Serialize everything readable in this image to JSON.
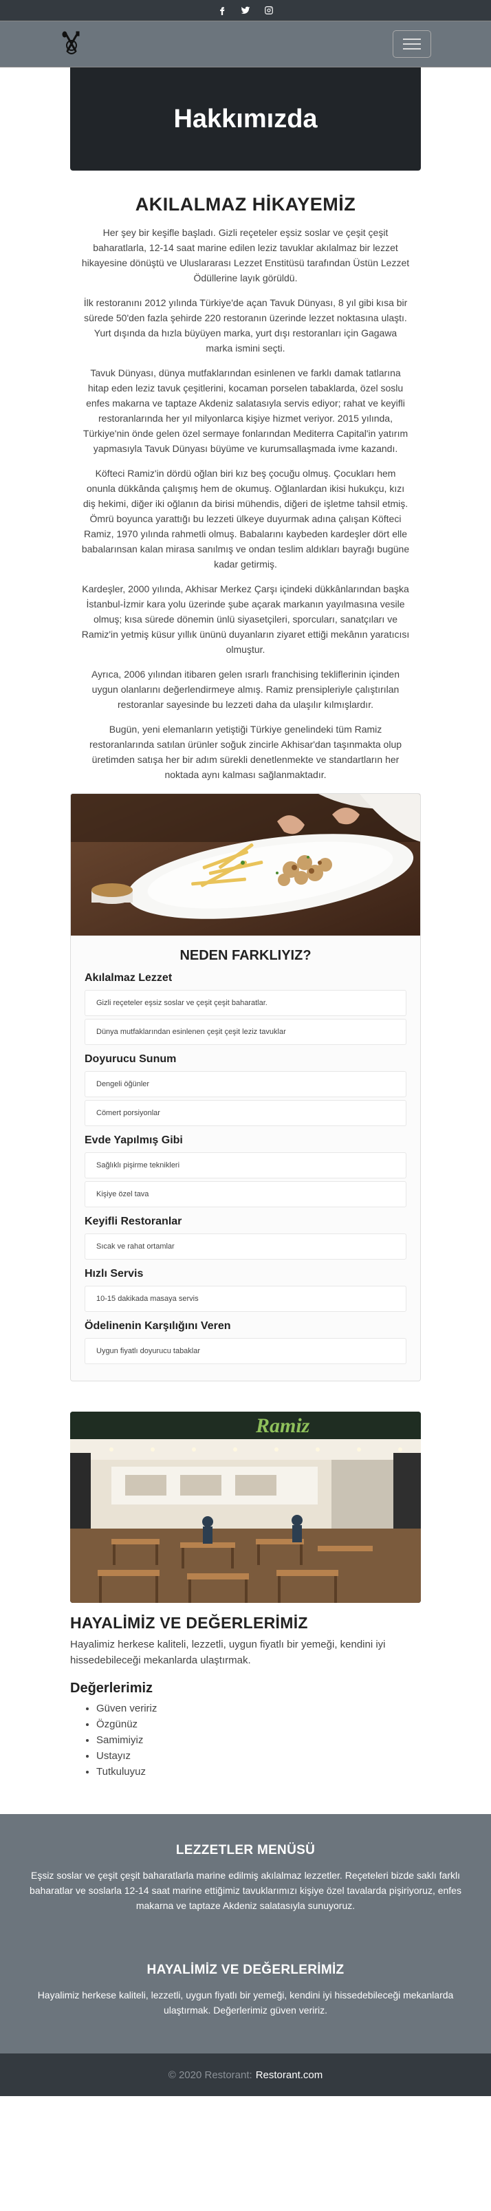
{
  "header": {
    "social": [
      "facebook-icon",
      "twitter-icon",
      "instagram-icon"
    ]
  },
  "hero": {
    "title": "Hakkımızda"
  },
  "story": {
    "title": "AKILALMAZ HİKAYEMİZ",
    "paragraphs": [
      "Her şey bir keşifle başladı. Gizli reçeteler eşsiz soslar ve çeşit çeşit baharatlarla, 12-14 saat marine edilen leziz tavuklar akılalmaz bir lezzet hikayesine dönüştü ve Uluslararası Lezzet Enstitüsü tarafından Üstün Lezzet Ödüllerine layık görüldü.",
      "İlk restoranını 2012 yılında Türkiye'de açan Tavuk Dünyası, 8 yıl gibi kısa bir sürede 50'den fazla şehirde 220 restoranın üzerinde lezzet noktasına ulaştı. Yurt dışında da hızla büyüyen marka, yurt dışı restoranları için Gagawa marka ismini seçti.",
      "Tavuk Dünyası, dünya mutfaklarından esinlenen ve farklı damak tatlarına hitap eden leziz tavuk çeşitlerini, kocaman porselen tabaklarda, özel soslu enfes makarna ve taptaze Akdeniz salatasıyla servis ediyor; rahat ve keyifli restoranlarında her yıl milyonlarca kişiye hizmet veriyor. 2015 yılında, Türkiye'nin önde gelen özel sermaye fonlarından Mediterra Capital'in yatırım yapmasıyla Tavuk Dünyası büyüme ve kurumsallaşmada ivme kazandı.",
      "Köfteci Ramiz'in dördü oğlan biri kız beş çocuğu olmuş. Çocukları hem onunla dükkânda çalışmış hem de okumuş. Oğlanlardan ikisi hukukçu, kızı diş hekimi, diğer iki oğlanın da birisi mühendis, diğeri de işletme tahsil etmiş. Ömrü boyunca yarattığı bu lezzeti ülkeye duyurmak adına çalışan Köfteci Ramiz, 1970 yılında rahmetli olmuş. Babalarını kaybeden kardeşler dört elle babalarınsan kalan mirasa sanılmış ve ondan teslim aldıkları bayrağı bugüne kadar getirmiş.",
      "Kardeşler, 2000 yılında, Akhisar Merkez Çarşı içindeki dükkânlarından başka İstanbul-İzmir kara yolu üzerinde şube açarak markanın yayılmasına vesile olmuş; kısa sürede dönemin ünlü siyasetçileri, sporcuları, sanatçıları ve Ramiz'in yetmiş küsur yıllık ününü duyanların ziyaret ettiği mekânın yaratıcısı olmuştur.",
      "Ayrıca, 2006 yılından itibaren gelen ısrarlı franchising tekliflerinin içinden uygun olanlarını değerlendirmeye almış. Ramiz prensipleriyle çalıştırılan restoranlar sayesinde bu lezzeti daha da ulaşılır kılmışlardır.",
      "Bugün, yeni elemanların yetiştiği Türkiye genelindeki tüm Ramiz restoranlarında satılan ürünler soğuk zincirle Akhisar'dan taşınmakta olup üretimden satışa her bir adım sürekli denetlenmekte ve standartların her noktada aynı kalması sağlanmaktadır."
    ]
  },
  "features": {
    "title": "NEDEN FARKLIYIZ?",
    "groups": [
      {
        "heading": "Akılalmaz Lezzet",
        "items": [
          "Gizli reçeteler eşsiz soslar ve çeşit çeşit baharatlar.",
          "Dünya mutfaklarından esinlenen çeşit çeşit leziz tavuklar"
        ]
      },
      {
        "heading": "Doyurucu Sunum",
        "items": [
          "Dengeli öğünler",
          "Cömert porsiyonlar"
        ]
      },
      {
        "heading": "Evde Yapılmış Gibi",
        "items": [
          "Sağlıklı pişirme teknikleri",
          "Kişiye özel tava"
        ]
      },
      {
        "heading": "Keyifli Restoranlar",
        "items": [
          "Sıcak ve rahat ortamlar"
        ]
      },
      {
        "heading": "Hızlı Servis",
        "items": [
          "10-15 dakikada masaya servis"
        ]
      },
      {
        "heading": "Ödelinenin Karşılığını Veren",
        "items": [
          "Uygun fiyatlı doyurucu tabaklar"
        ]
      }
    ]
  },
  "store_sign": "Ramiz",
  "values": {
    "title": "HAYALİMİZ VE DEĞERLERİMİZ",
    "text": "Hayalimiz herkese kaliteli, lezzetli, uygun fiyatlı bir yemeği, kendini iyi hissedebileceği mekanlarda ulaştırmak.",
    "subtitle": "Değerlerimiz",
    "list": [
      "Güven veririz",
      "Özgünüz",
      "Samimiyiz",
      "Ustayız",
      "Tutkuluyuz"
    ]
  },
  "footer": {
    "menu_title": "LEZZETLER MENÜSÜ",
    "menu_text": "Eşsiz soslar ve çeşit çeşit baharatlarla marine edilmiş akılalmaz lezzetler. Reçeteleri bizde saklı farklı baharatlar ve soslarla 12-14 saat marine ettiğimiz tavuklarımızı kişiye özel tavalarda pişiriyoruz, enfes makarna ve taptaze Akdeniz salatasıyla sunuyoruz.",
    "values_title": "HAYALİMİZ VE DEĞERLERİMİZ",
    "values_text": "Hayalimiz herkese kaliteli, lezzetli, uygun fiyatlı bir yemeği, kendini iyi hissedebileceği mekanlarda ulaştırmak. Değerlerimiz güven veririz.",
    "copyright": "© 2020 Restorant:",
    "copyright_link": "Restorant.com"
  },
  "colors": {
    "topbar": "#343a40",
    "navbar": "#6c757d",
    "hero": "#212529",
    "footer": "#6c757d"
  }
}
